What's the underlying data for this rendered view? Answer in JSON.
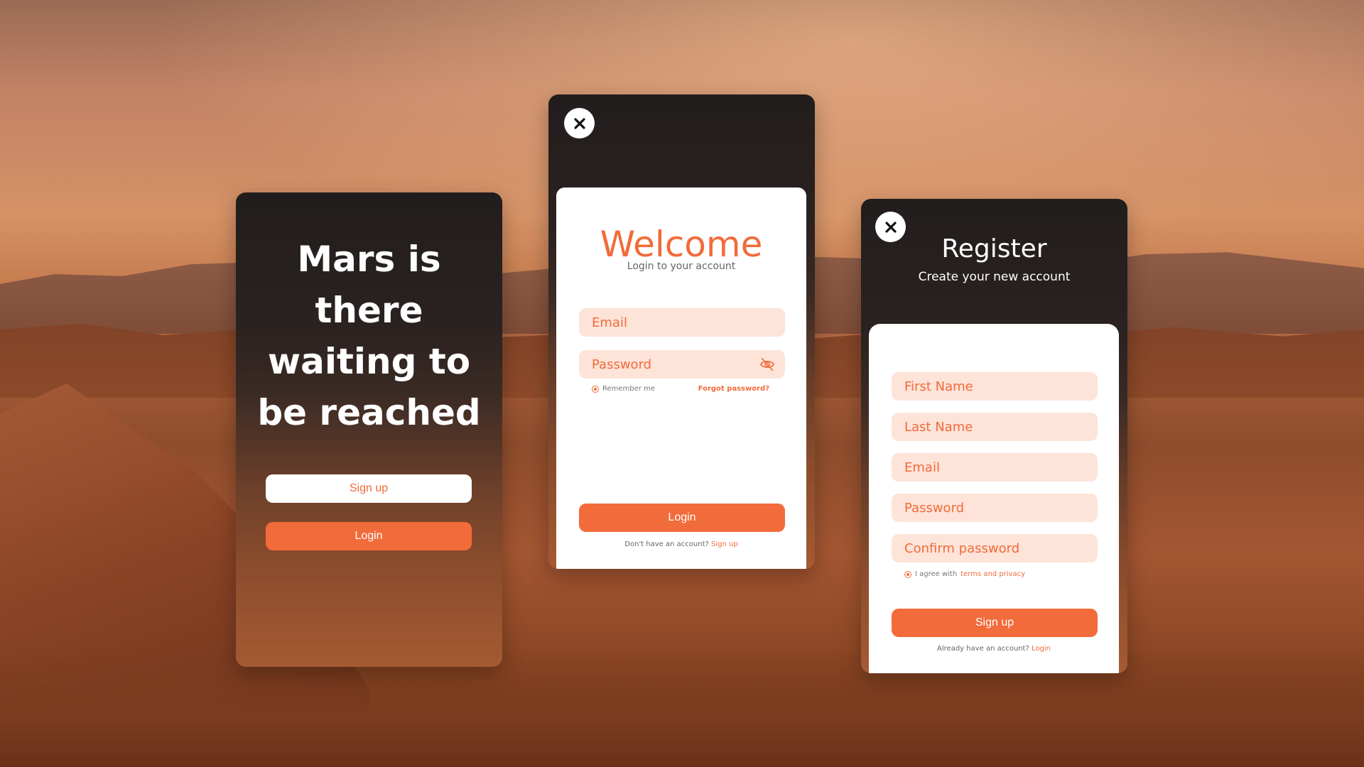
{
  "hero": {
    "title": "Mars is there waiting to be reached",
    "signup_label": "Sign up",
    "login_label": "Login"
  },
  "login": {
    "title": "Welcome",
    "subtitle": "Login to your account",
    "email_placeholder": "Email",
    "password_placeholder": "Password",
    "remember_label": "Remember me",
    "forgot_label": "Forgot password?",
    "login_button": "Login",
    "footer_text": "Don't have an account?",
    "footer_link": "Sign up"
  },
  "register": {
    "title": "Register",
    "subtitle": "Create your new account",
    "first_name_placeholder": "First Name",
    "last_name_placeholder": "Last Name",
    "email_placeholder": "Email",
    "password_placeholder": "Password",
    "confirm_password_placeholder": "Confirm password",
    "agree_text": "I agree with",
    "agree_link": "terms and privacy",
    "signup_button": "Sign up",
    "footer_text": "Already have an account?",
    "footer_link": "Login"
  },
  "icons": {
    "close": "close-icon",
    "eye_off": "eye-off-icon"
  },
  "colors": {
    "accent": "#f26b3a",
    "field_bg": "#fde3d8",
    "card_dark": "#221d1d"
  }
}
